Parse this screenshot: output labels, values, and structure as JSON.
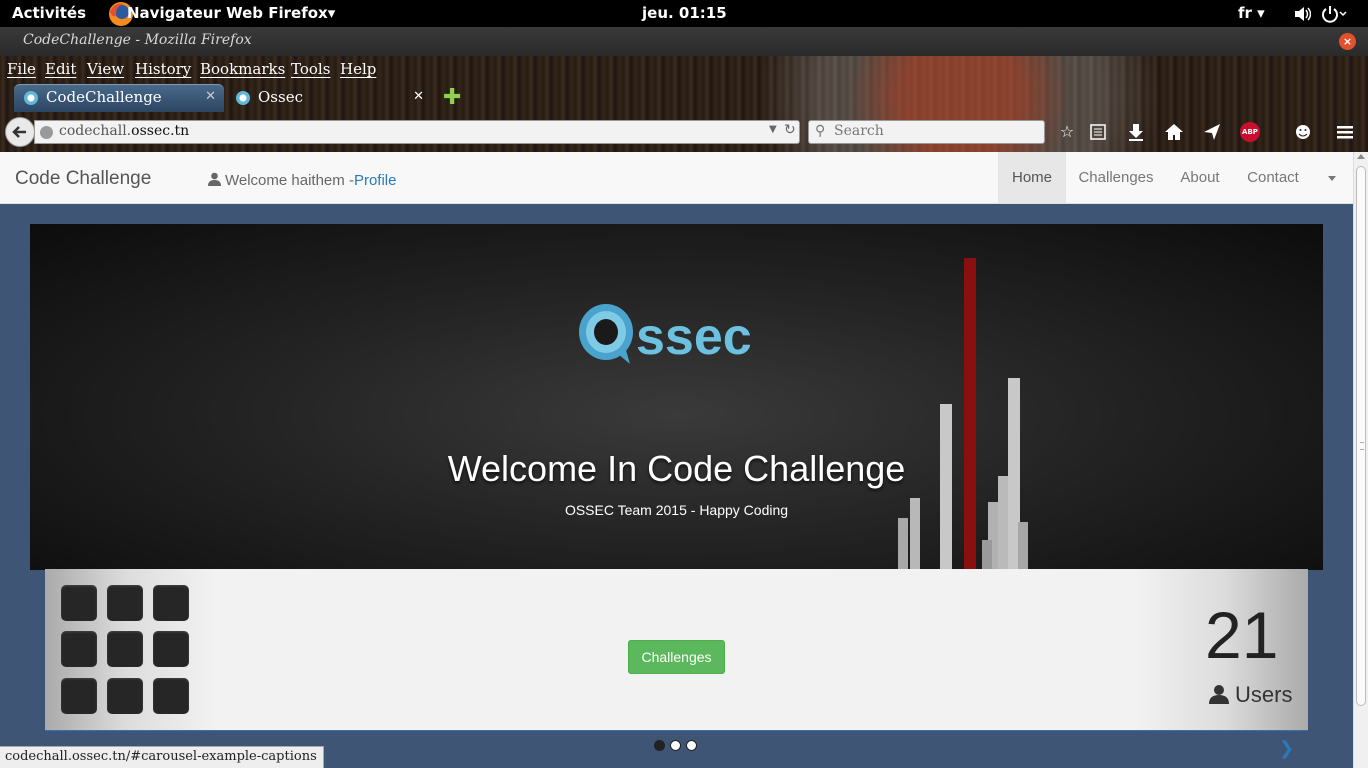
{
  "system": {
    "activities": "Activités",
    "app_menu": "Navigateur Web Firefox▾",
    "clock": "jeu. 01:15",
    "lang": "fr ▾"
  },
  "window": {
    "title": "CodeChallenge - Mozilla Firefox"
  },
  "menu": [
    "File",
    "Edit",
    "View",
    "History",
    "Bookmarks",
    "Tools",
    "Help"
  ],
  "tabs": [
    {
      "label": "CodeChallenge",
      "active": true
    },
    {
      "label": "Ossec",
      "active": false
    }
  ],
  "urlbar": {
    "domain_prefix": "codechall.",
    "domain_main": "ossec.tn"
  },
  "search": {
    "placeholder": "Search"
  },
  "toolbar_icons": [
    "bookmark-star-icon",
    "reading-list-icon",
    "download-icon",
    "home-icon",
    "share-icon",
    "adblock-plus-icon",
    "smiley-icon",
    "hamburger-menu-icon"
  ],
  "site": {
    "brand": "Code Challenge",
    "welcome": "Welcome haithem -",
    "profile_link": "Profile",
    "nav": [
      "Home",
      "Challenges",
      "About",
      "Contact"
    ],
    "active_nav": "Home"
  },
  "hero": {
    "title": "Welcome In Code Challenge",
    "subtitle": "OSSEC Team 2015 - Happy Coding",
    "logo_text": "ssec"
  },
  "panel": {
    "button": "Challenges",
    "users_count": "21",
    "users_label": "Users"
  },
  "carousel": {
    "slides": 3,
    "active": 0
  },
  "status": {
    "url": "codechall.ossec.tn/#carousel-example-captions"
  },
  "colors": {
    "page_bg": "#3f5576",
    "brand_link": "#2a7ab8",
    "button_green": "#5cb85c",
    "abp_red": "#c8102e"
  }
}
